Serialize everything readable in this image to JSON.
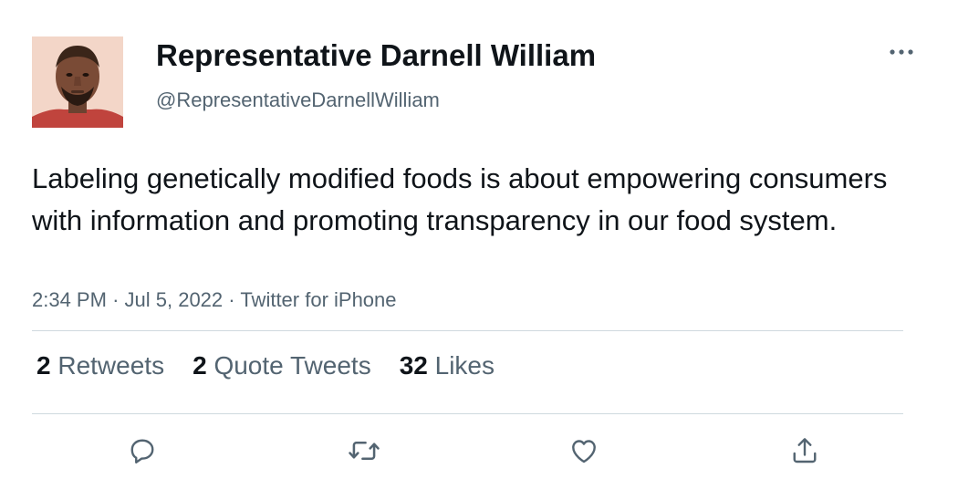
{
  "tweet": {
    "author": {
      "display_name": "Representative Darnell William",
      "handle": "@RepresentativeDarnellWilliam"
    },
    "text": "Labeling genetically modified foods is about empowering consumers with information and promoting transparency in our food system.",
    "meta": {
      "time": "2:34 PM",
      "date": "Jul 5, 2022",
      "source": "Twitter for iPhone",
      "separator": "·"
    },
    "stats": {
      "retweets": {
        "count": "2",
        "label": "Retweets"
      },
      "quote_tweets": {
        "count": "2",
        "label": "Quote Tweets"
      },
      "likes": {
        "count": "32",
        "label": "Likes"
      }
    },
    "actions": [
      {
        "name": "reply",
        "icon": "reply-icon"
      },
      {
        "name": "retweet",
        "icon": "retweet-icon"
      },
      {
        "name": "like",
        "icon": "heart-icon"
      },
      {
        "name": "share",
        "icon": "share-icon"
      }
    ],
    "more_icon": "more-icon"
  },
  "colors": {
    "text_primary": "#0f1419",
    "text_secondary": "#536471",
    "divider": "#cfd9de"
  }
}
